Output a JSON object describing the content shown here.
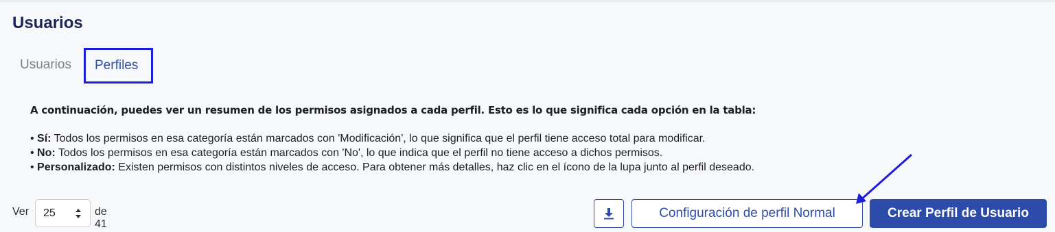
{
  "page": {
    "title": "Usuarios"
  },
  "tabs": [
    {
      "label": "Usuarios",
      "active": false
    },
    {
      "label": "Perfiles",
      "active": true
    }
  ],
  "description": {
    "intro": "A continuación, puedes ver un resumen de los permisos asignados a cada perfil. Esto es lo que significa cada opción en la tabla:",
    "items": [
      {
        "term": "Sí:",
        "text": " Todos los permisos en esa categoría están marcados con 'Modificación', lo que significa que el perfil tiene acceso total para modificar."
      },
      {
        "term": "No:",
        "text": " Todos los permisos en esa categoría están marcados con 'No', lo que indica que el perfil no tiene acceso a dichos permisos."
      },
      {
        "term": "Personalizado:",
        "text": " Existen permisos con distintos niveles de acceso. Para obtener más detalles, haz clic en el ícono de la lupa junto al perfil deseado."
      }
    ]
  },
  "pagination": {
    "prefix": "Ver",
    "page_size": "25",
    "suffix": "de 41"
  },
  "toolbar": {
    "download_icon": "download-icon",
    "config_label": "Configuración de perfil Normal",
    "create_label": "Crear Perfil de Usuario"
  },
  "colors": {
    "title": "#1b2554",
    "accent": "#2d4ba8",
    "highlight": "#1c1ddb",
    "background": "#f7f8fa"
  }
}
